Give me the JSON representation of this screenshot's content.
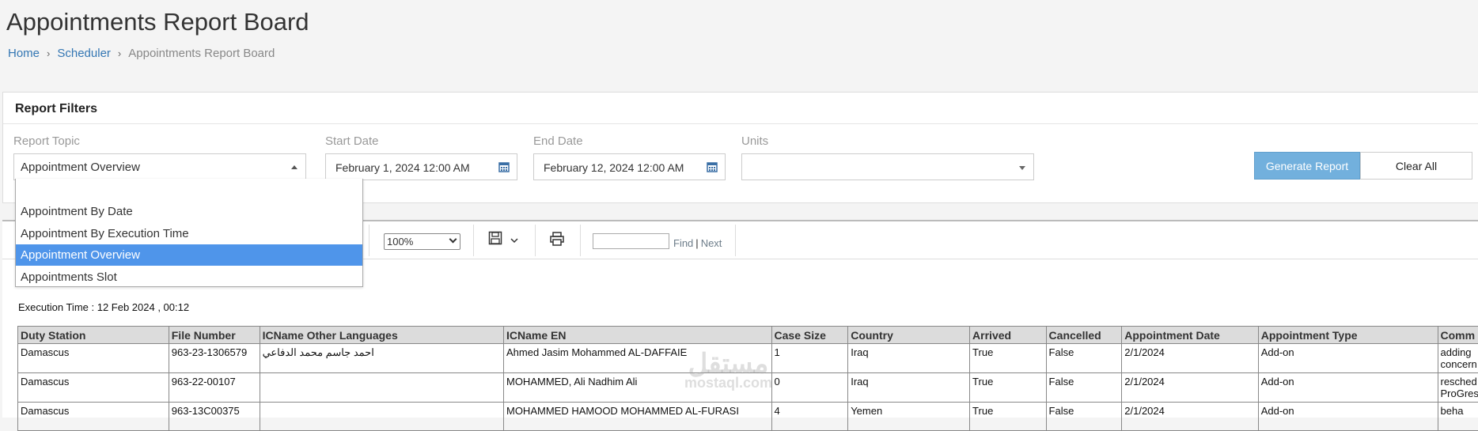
{
  "page": {
    "title": "Appointments Report Board",
    "breadcrumb": [
      "Home",
      "Scheduler",
      "Appointments Report Board"
    ]
  },
  "filters": {
    "title": "Report Filters",
    "report_topic": {
      "label": "Report Topic",
      "value": "Appointment Overview",
      "options": [
        "",
        "Appointment By Date",
        "Appointment By Execution Time",
        "Appointment Overview",
        "Appointments Slot"
      ],
      "selected_index": 3
    },
    "start_date": {
      "label": "Start Date",
      "value": "February 1, 2024 12:00 AM"
    },
    "end_date": {
      "label": "End Date",
      "value": "February 12, 2024 12:00 AM"
    },
    "units": {
      "label": "Units",
      "value": ""
    },
    "generate_label": "Generate Report",
    "clear_label": "Clear All"
  },
  "viewer": {
    "zoom": "100%",
    "find_label": "Find",
    "separator": "|",
    "next_label": "Next",
    "execution_time": "Execution Time : 12 Feb 2024 , 00:12"
  },
  "table": {
    "columns": [
      "Duty Station",
      "File Number",
      "ICName Other Languages",
      "ICName EN",
      "Case Size",
      "Country",
      "Arrived",
      "Cancelled",
      "Appointment Date",
      "Appointment Type",
      "Comm"
    ],
    "rows": [
      [
        "Damascus",
        "963-23-1306579",
        "احمد جاسم محمد الدفاعي",
        "Ahmed Jasim Mohammed AL-DAFFAIE",
        "1",
        "Iraq",
        "True",
        "False",
        "2/1/2024",
        "Add-on",
        "adding\nconcern"
      ],
      [
        "Damascus",
        "963-22-00107",
        "",
        "MOHAMMED, Ali Nadhim Ali",
        "0",
        "Iraq",
        "True",
        "False",
        "2/1/2024",
        "Add-on",
        "resched\nProGres"
      ],
      [
        "Damascus",
        "963-13C00375",
        "",
        "MOHAMMED HAMOOD MOHAMMED  AL-FURASI",
        "4",
        "Yemen",
        "True",
        "False",
        "2/1/2024",
        "Add-on",
        "beha"
      ]
    ]
  },
  "watermark": {
    "line1": "مستقل",
    "line2": "mostaql.com"
  },
  "colors": {
    "accent": "#4f95ea",
    "generate_bg": "#72b0dd",
    "link": "#3376b3"
  }
}
